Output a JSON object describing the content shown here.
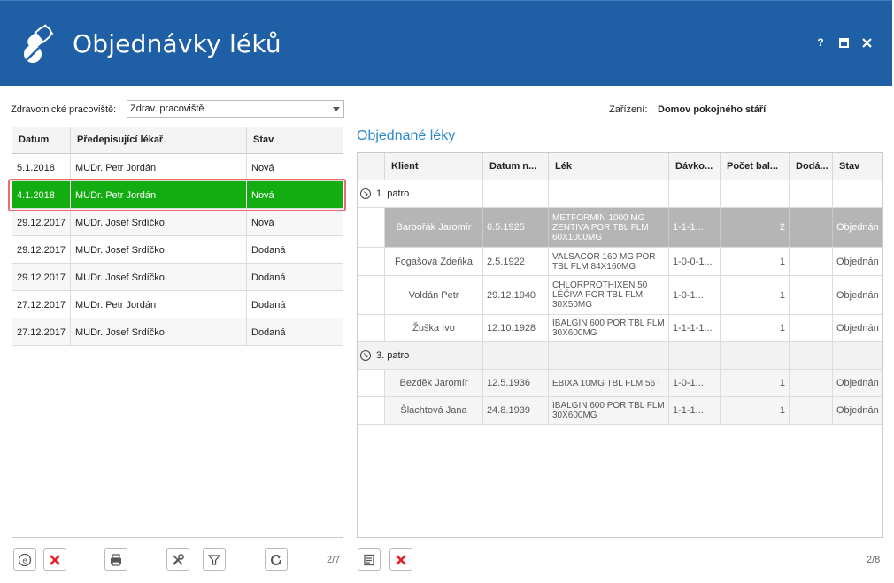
{
  "header": {
    "title": "Objednávky léků",
    "controls": [
      "?",
      "maximize",
      "close"
    ],
    "colors": {
      "background": "#1f5fa6",
      "text": "#ffffff"
    }
  },
  "filter": {
    "pracoviste_label": "Zdravotnické pracoviště:",
    "pracoviste_value": "Zdrav. pracoviště",
    "zarizeni_label": "Zařízení:",
    "zarizeni_value": "Domov pokojného stáří"
  },
  "orders": {
    "columns": [
      "Datum",
      "Předepisující lékař",
      "Stav"
    ],
    "rows": [
      {
        "date": "5.1.2018",
        "doctor": "MUDr. Petr Jordán",
        "status": "Nová"
      },
      {
        "date": "4.1.2018",
        "doctor": "MUDr. Petr Jordán",
        "status": "Nová"
      },
      {
        "date": "29.12.2017",
        "doctor": "MUDr. Josef Srdíčko",
        "status": "Nová"
      },
      {
        "date": "29.12.2017",
        "doctor": "MUDr. Josef Srdíčko",
        "status": "Dodaná"
      },
      {
        "date": "29.12.2017",
        "doctor": "MUDr. Josef Srdíčko",
        "status": "Dodaná"
      },
      {
        "date": "27.12.2017",
        "doctor": "MUDr. Petr Jordán",
        "status": "Dodaná"
      },
      {
        "date": "27.12.2017",
        "doctor": "MUDr. Josef Srdíčko",
        "status": "Dodaná"
      }
    ],
    "selected_index": 1,
    "selected_color": "#13ad11",
    "pager": "2/7"
  },
  "ordered": {
    "title": "Objednané léky",
    "columns": [
      "",
      "Klient",
      "Datum n...",
      "Lék",
      "Dávko...",
      "Počet bal...",
      "Dodá...",
      "Stav"
    ],
    "groups": [
      {
        "name": "1. patro",
        "items": [
          {
            "client": "Barbořák Jaromír",
            "date": "6.5.1925",
            "drug": "METFORMIN 1000 MG ZENTIVA POR TBL FLM 60X1000MG",
            "dose": "1-1-1...",
            "count": "2",
            "delivered": "",
            "status": "Objednán"
          },
          {
            "client": "Fogašová Zdeňka",
            "date": "2.5.1922",
            "drug": "VALSACOR 160 MG POR TBL FLM 84X160MG",
            "dose": "1-0-0-1...",
            "count": "1",
            "delivered": "",
            "status": "Objednán"
          },
          {
            "client": "Voldán Petr",
            "date": "29.12.1940",
            "drug": "CHLORPROTHIXEN 50 LÉČIVA POR TBL FLM 30X50MG",
            "dose": "1-0-1...",
            "count": "1",
            "delivered": "",
            "status": "Objednán"
          },
          {
            "client": "Žuška Ivo",
            "date": "12.10.1928",
            "drug": "IBALGIN 600 POR TBL FLM 30X600MG",
            "dose": "1-1-1-1...",
            "count": "1",
            "delivered": "",
            "status": "Objednán"
          }
        ]
      },
      {
        "name": "3. patro",
        "items": [
          {
            "client": "Bezděk Jaromír",
            "date": "12.5.1936",
            "drug": "EBIXA 10MG TBL FLM 56 I",
            "dose": "1-0-1...",
            "count": "1",
            "delivered": "",
            "status": "Objednán"
          },
          {
            "client": "Šlachtová Jana",
            "date": "24.8.1939",
            "drug": "IBALGIN 600 POR TBL FLM 30X600MG",
            "dose": "1-1-1...",
            "count": "1",
            "delivered": "",
            "status": "Objednán"
          }
        ]
      }
    ],
    "pager": "2/8"
  },
  "toolbar_left": [
    "edit-e-icon",
    "delete-icon",
    "print-icon",
    "tools-icon",
    "filter-icon",
    "refresh-icon"
  ],
  "toolbar_right": [
    "form-icon",
    "delete-icon"
  ]
}
